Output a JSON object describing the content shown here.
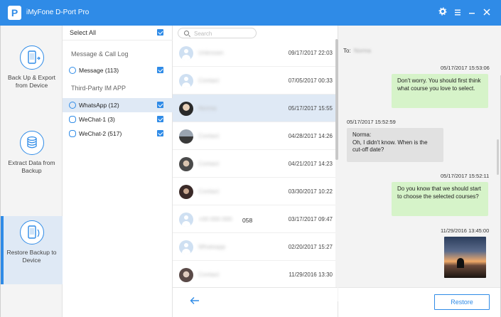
{
  "window": {
    "title": "iMyFone D-Port Pro",
    "logo_letter": "P",
    "controls": [
      "gear-icon",
      "menu-icon",
      "minimize-icon",
      "close-icon"
    ]
  },
  "nav": [
    {
      "label": "Back Up & Export from Device",
      "icon": "phone-export-icon",
      "active": false
    },
    {
      "label": "Extract Data from Backup",
      "icon": "database-icon",
      "active": false
    },
    {
      "label": "Restore Backup to Device",
      "icon": "phone-restore-icon",
      "active": true
    }
  ],
  "categories": {
    "select_all_label": "Select All",
    "section1_title": "Message & Call Log",
    "section2_title": "Third-Party IM APP",
    "items": [
      {
        "label": "Message (113)",
        "icon": "message-bubble-icon",
        "checked": true
      },
      {
        "label": "WhatsApp (12)",
        "icon": "whatsapp-icon",
        "checked": true,
        "selected": true
      },
      {
        "label": "WeChat-1 (3)",
        "icon": "wechat-icon",
        "checked": true
      },
      {
        "label": "WeChat-2 (517)",
        "icon": "wechat-icon",
        "checked": true
      }
    ]
  },
  "contacts": {
    "search_placeholder": "Search",
    "rows": [
      {
        "name": "Unknown",
        "date": "09/17/2017 22:03",
        "avatar": "default"
      },
      {
        "name": "Contact",
        "date": "07/05/2017 00:33",
        "avatar": "default"
      },
      {
        "name": "Norma",
        "date": "05/17/2017 15:55",
        "avatar": "photo",
        "selected": true
      },
      {
        "name": "Contact",
        "date": "04/28/2017 14:26",
        "avatar": "photo"
      },
      {
        "name": "Contact",
        "date": "04/21/2017 14:23",
        "avatar": "photo"
      },
      {
        "name": "Contact",
        "date": "03/30/2017 10:22",
        "avatar": "photo"
      },
      {
        "name": "058",
        "date": "03/17/2017 09:47",
        "avatar": "default"
      },
      {
        "name": "Whatsapp",
        "date": "02/20/2017 15:27",
        "avatar": "default"
      },
      {
        "name": "Contact",
        "date": "11/29/2016 13:30",
        "avatar": "photo"
      }
    ]
  },
  "chat": {
    "to_label": "To:",
    "to_name": "Norma",
    "messages": [
      {
        "time": "05/17/2017 15:53:06",
        "dir": "out",
        "text": "Don't worry. You should first think what course you love to select."
      },
      {
        "time": "05/17/2017 15:52:59",
        "dir": "in",
        "text": "Norma:\nOh, I didn't know. When is the cut-off date?"
      },
      {
        "time": "05/17/2017 15:52:11",
        "dir": "out",
        "text": "Do you know that we should start to choose the selected courses?"
      },
      {
        "time": "11/29/2016 13:45:00",
        "dir": "out",
        "text": ""
      }
    ],
    "restore_label": "Restore"
  }
}
